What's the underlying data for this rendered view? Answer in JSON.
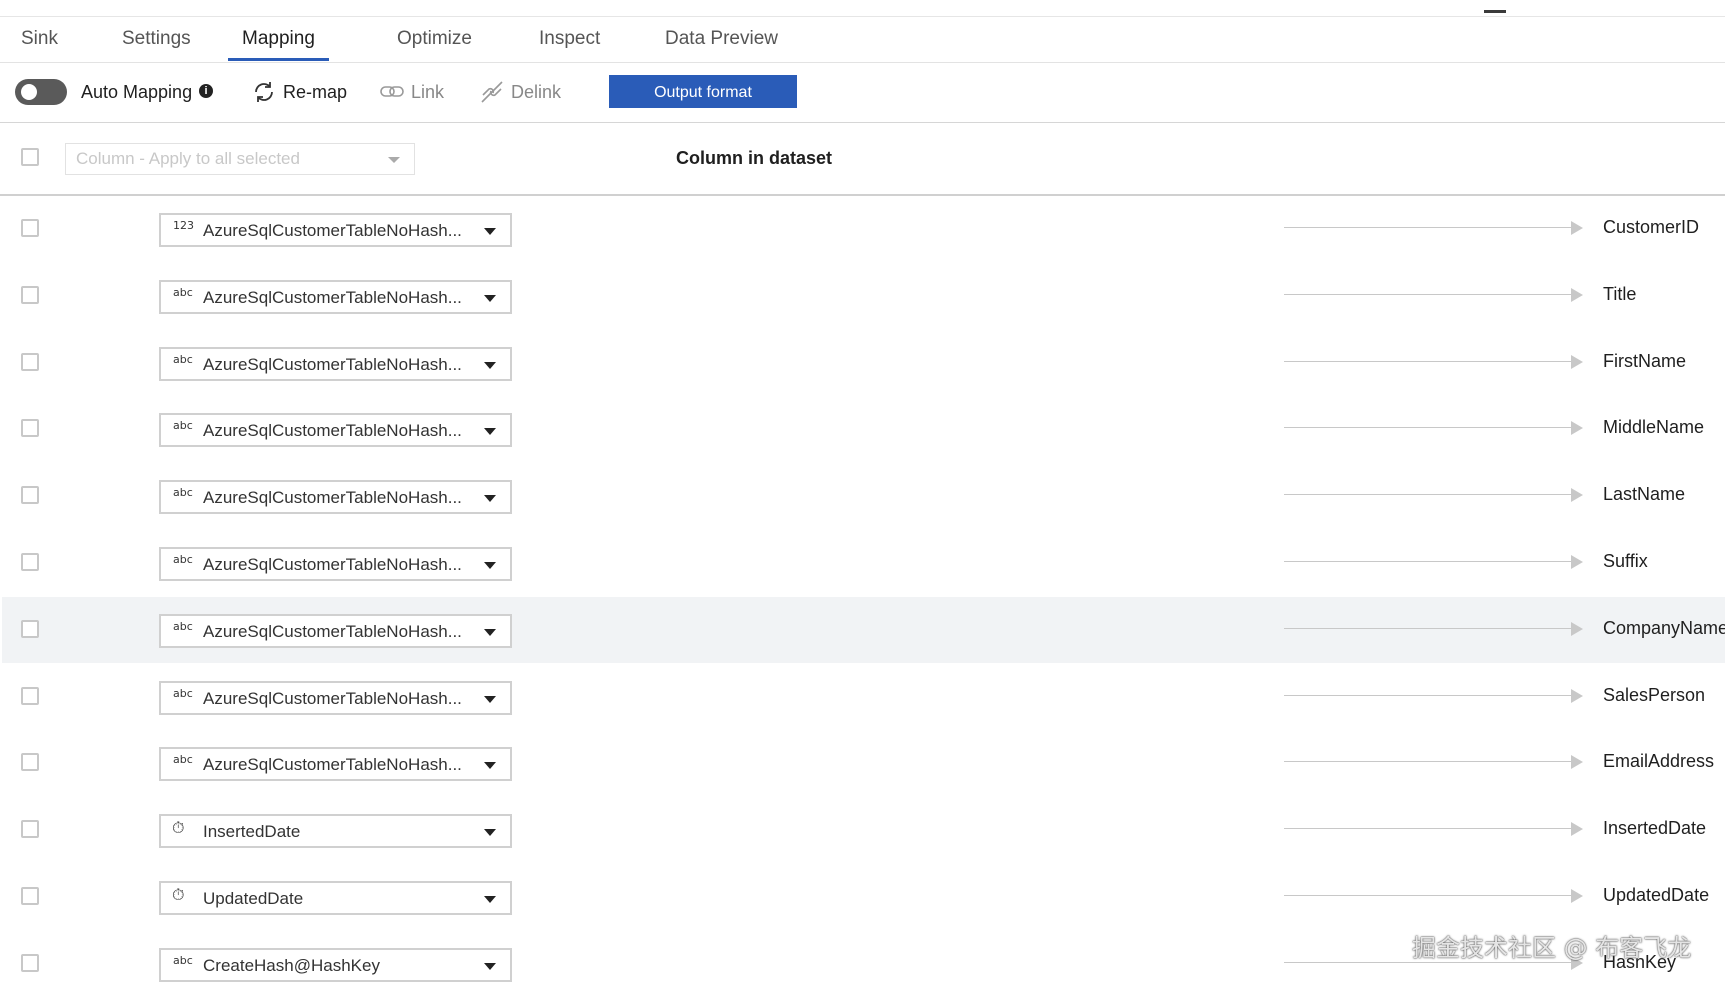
{
  "tabs": [
    {
      "label": "Sink"
    },
    {
      "label": "Settings"
    },
    {
      "label": "Mapping"
    },
    {
      "label": "Optimize"
    },
    {
      "label": "Inspect"
    },
    {
      "label": "Data Preview"
    }
  ],
  "active_tab": "Mapping",
  "toolbar": {
    "auto_mapping_label": "Auto Mapping",
    "auto_mapping_on": false,
    "info_icon": "i",
    "remap_label": "Re-map",
    "link_label": "Link",
    "delink_label": "Delink",
    "output_format_label": "Output format",
    "accent_color": "#2a5cb8"
  },
  "header": {
    "apply_placeholder": "Column - Apply to all selected",
    "column_in_dataset": "Column in dataset"
  },
  "rows": [
    {
      "type": "123",
      "source": "AzureSqlCustomerTableNoHash...",
      "dest": "CustomerID"
    },
    {
      "type": "abc",
      "source": "AzureSqlCustomerTableNoHash...",
      "dest": "Title"
    },
    {
      "type": "abc",
      "source": "AzureSqlCustomerTableNoHash...",
      "dest": "FirstName"
    },
    {
      "type": "abc",
      "source": "AzureSqlCustomerTableNoHash...",
      "dest": "MiddleName"
    },
    {
      "type": "abc",
      "source": "AzureSqlCustomerTableNoHash...",
      "dest": "LastName"
    },
    {
      "type": "abc",
      "source": "AzureSqlCustomerTableNoHash...",
      "dest": "Suffix"
    },
    {
      "type": "abc",
      "source": "AzureSqlCustomerTableNoHash...",
      "dest": "CompanyName",
      "highlighted": true
    },
    {
      "type": "abc",
      "source": "AzureSqlCustomerTableNoHash...",
      "dest": "SalesPerson"
    },
    {
      "type": "abc",
      "source": "AzureSqlCustomerTableNoHash...",
      "dest": "EmailAddress"
    },
    {
      "type": "clock-icon",
      "source": "InsertedDate",
      "dest": "InsertedDate"
    },
    {
      "type": "clock-icon",
      "source": "UpdatedDate",
      "dest": "UpdatedDate"
    },
    {
      "type": "abc",
      "source": "CreateHash@HashKey",
      "dest": "HashKey"
    }
  ],
  "watermark": "掘金技术社区 @ 布客飞龙"
}
